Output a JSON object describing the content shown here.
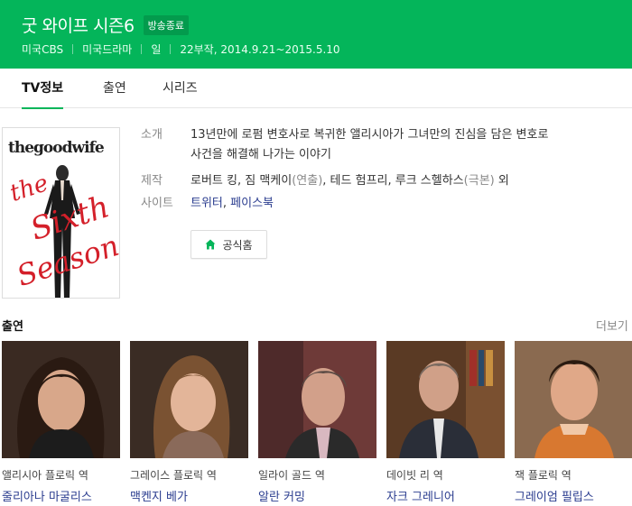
{
  "header": {
    "title": "굿 와이프 시즌6",
    "status_badge": "방송종료",
    "meta": [
      "미국CBS",
      "미국드라마",
      "일",
      "22부작, 2014.9.21~2015.5.10"
    ],
    "bg_color": "#04b55a"
  },
  "tabs": [
    {
      "label": "TV정보",
      "active": true
    },
    {
      "label": "출연",
      "active": false
    },
    {
      "label": "시리즈",
      "active": false
    }
  ],
  "poster": {
    "logo_text": "thegoodwife",
    "script_text_1": "the",
    "script_text_2": "Sixth",
    "script_text_3": "Season"
  },
  "info": {
    "intro_label": "소개",
    "intro_line1": "13년만에 로펌 변호사로 복귀한 앨리시아가 그녀만의 진심을 담은 변호로",
    "intro_line2": "사건을 해결해 나가는 이야기",
    "production_label": "제작",
    "production_names": "로버트 킹, 짐 맥케이",
    "production_role1": "(연출)",
    "production_names2": ", 테드 험프리, 루크 스헬하스",
    "production_role2": "(극본)",
    "production_suffix": " 외",
    "site_label": "사이트",
    "site_link1": "트위터",
    "site_sep": ", ",
    "site_link2": "페이스북"
  },
  "home_button": {
    "label": "공식홈",
    "icon": "home-icon"
  },
  "cast": {
    "heading": "출연",
    "more": "더보기",
    "members": [
      {
        "role": "앨리시아 플로릭 역",
        "name": "줄리아나 마굴리스"
      },
      {
        "role": "그레이스 플로릭 역",
        "name": "맥켄지 베가"
      },
      {
        "role": "일라이 골드 역",
        "name": "알란 커밍"
      },
      {
        "role": "데이빗 리 역",
        "name": "자크 그레니어"
      },
      {
        "role": "잭 플로릭 역",
        "name": "그레이엄 필립스"
      }
    ]
  },
  "colors": {
    "accent": "#04b55a",
    "link": "#2a3c8f",
    "poster_red": "#d4202a"
  }
}
